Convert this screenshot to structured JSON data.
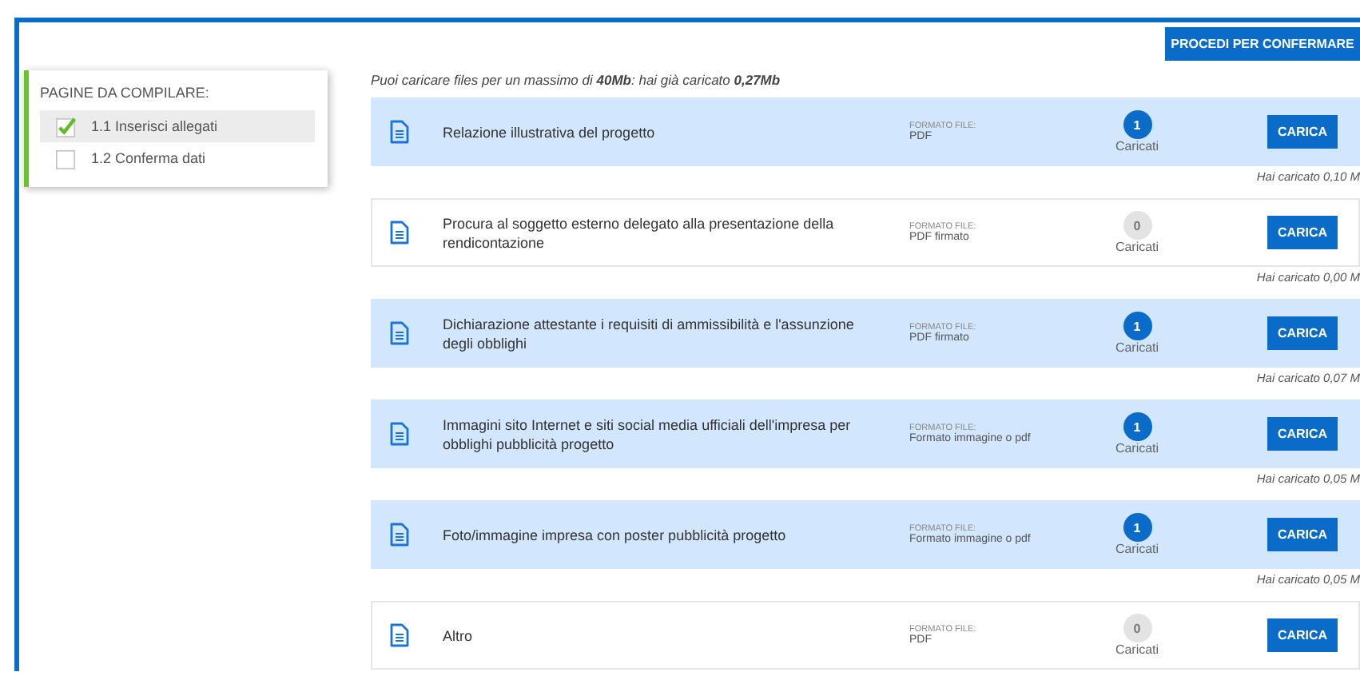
{
  "sidebar": {
    "title": "PAGINE DA COMPILARE:",
    "items": [
      {
        "label": "1.1 Inserisci allegati",
        "checked": true,
        "selected": true
      },
      {
        "label": "1.2 Conferma dati",
        "checked": false,
        "selected": false
      }
    ]
  },
  "confirm_button": "PROCEDI PER CONFERMARE",
  "note": "Puoi caricare files per un massimo di **40Mb**: hai già caricato **0,27Mb**",
  "attachments": [
    {
      "title": "Relazione illustrativa del progetto",
      "format_label": "FORMATO FILE:",
      "format": "PDF",
      "count": "1",
      "count_label": "Caricati",
      "uploaded": true,
      "button": "CARICA",
      "caption": "Hai caricato 0,10 M"
    },
    {
      "title": "Procura al soggetto esterno delegato alla presentazione della rendicontazione",
      "format_label": "FORMATO FILE:",
      "format": "PDF firmato",
      "count": "0",
      "count_label": "Caricati",
      "uploaded": false,
      "button": "CARICA",
      "caption": "Hai caricato 0,00 M"
    },
    {
      "title": "Dichiarazione attestante i requisiti di ammissibilità e l'assunzione degli obblighi",
      "format_label": "FORMATO FILE:",
      "format": "PDF firmato",
      "count": "1",
      "count_label": "Caricati",
      "uploaded": true,
      "button": "CARICA",
      "caption": "Hai caricato 0,07 M"
    },
    {
      "title": "Immagini sito Internet e siti social media ufficiali dell'impresa per obblighi pubblicità progetto",
      "format_label": "FORMATO FILE:",
      "format": "Formato immagine o pdf",
      "count": "1",
      "count_label": "Caricati",
      "uploaded": true,
      "button": "CARICA",
      "caption": "Hai caricato 0,05 M"
    },
    {
      "title": "Foto/immagine impresa con poster pubblicità progetto",
      "format_label": "FORMATO FILE:",
      "format": "Formato immagine o pdf",
      "count": "1",
      "count_label": "Caricati",
      "uploaded": true,
      "button": "CARICA",
      "caption": "Hai caricato 0,05 M"
    },
    {
      "title": "Altro",
      "format_label": "FORMATO FILE:",
      "format": "PDF",
      "count": "0",
      "count_label": "Caricati",
      "uploaded": false,
      "button": "CARICA"
    }
  ]
}
